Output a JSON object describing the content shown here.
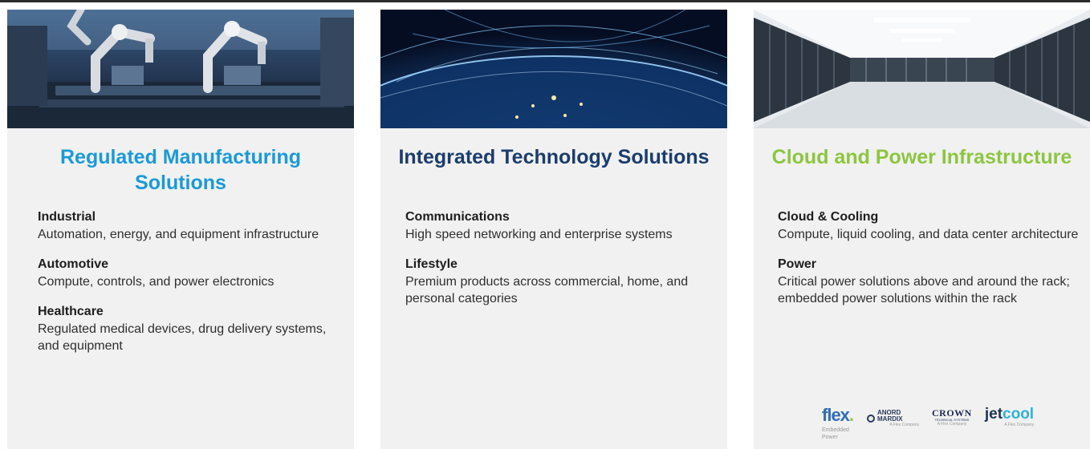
{
  "colors": {
    "card_background": "#f1f1f1",
    "manufacturing_title": "#1b9ad6",
    "technology_title": "#1b3d6d",
    "cloud_title": "#8cc63f"
  },
  "cards": [
    {
      "title": "Regulated Manufacturing Solutions",
      "image_icon": "robotic-arms-image",
      "sections": [
        {
          "title": "Industrial",
          "body": "Automation, energy, and equipment infrastructure"
        },
        {
          "title": "Automotive",
          "body": "Compute, controls, and power electronics"
        },
        {
          "title": "Healthcare",
          "body": "Regulated medical devices, drug delivery systems, and equipment"
        }
      ]
    },
    {
      "title": "Integrated Technology Solutions",
      "image_icon": "globe-network-image",
      "sections": [
        {
          "title": "Communications",
          "body": "High speed networking and enterprise systems"
        },
        {
          "title": "Lifestyle",
          "body": "Premium products across commercial, home, and personal categories"
        }
      ]
    },
    {
      "title": "Cloud and Power Infrastructure",
      "image_icon": "data-center-image",
      "sections": [
        {
          "title": "Cloud & Cooling",
          "body": "Compute, liquid cooling, and data center architecture"
        },
        {
          "title": "Power",
          "body": "Critical power solutions above and around the rack; embedded power solutions within the rack"
        }
      ]
    }
  ],
  "brands": {
    "flex": {
      "word": "flex",
      "dot": ".",
      "sub": "Embedded Power"
    },
    "anord": {
      "name": "ANORD MARDIX",
      "tag": "A Flex Company"
    },
    "crown": {
      "name": "CROWN",
      "sub": "TECHNICAL SYSTEMS",
      "tag": "A Flex Company"
    },
    "jetcool": {
      "jet": "jet",
      "cool": "cool",
      "tag": "A Flex Company"
    }
  }
}
